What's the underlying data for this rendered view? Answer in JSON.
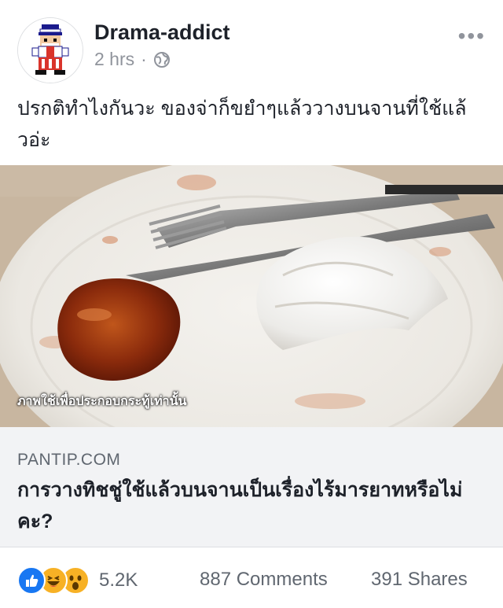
{
  "post": {
    "author": "Drama-addict",
    "time": "2 hrs",
    "separator": "·",
    "message": "ปรกติทำไงกันวะ ของจ่าก็ขยำๆแล้ววางบนจานที่ใช้แล้วอ่ะ",
    "image_caption": "ภาพใช้เพื่อประกอบกระทู้เท่านั้น",
    "more_label": "•••"
  },
  "link": {
    "domain": "PANTIP.COM",
    "title": "การวางทิชชู่ใช้แล้วบนจานเป็นเรื่องไร้มารยาทหรือไม่คะ?"
  },
  "footer": {
    "reaction_count": "5.2K",
    "comments": "887 Comments",
    "shares": "391 Shares"
  },
  "colors": {
    "accent": "#1877f2",
    "secondary_text": "#90949c",
    "link_bg": "#f2f3f5"
  }
}
